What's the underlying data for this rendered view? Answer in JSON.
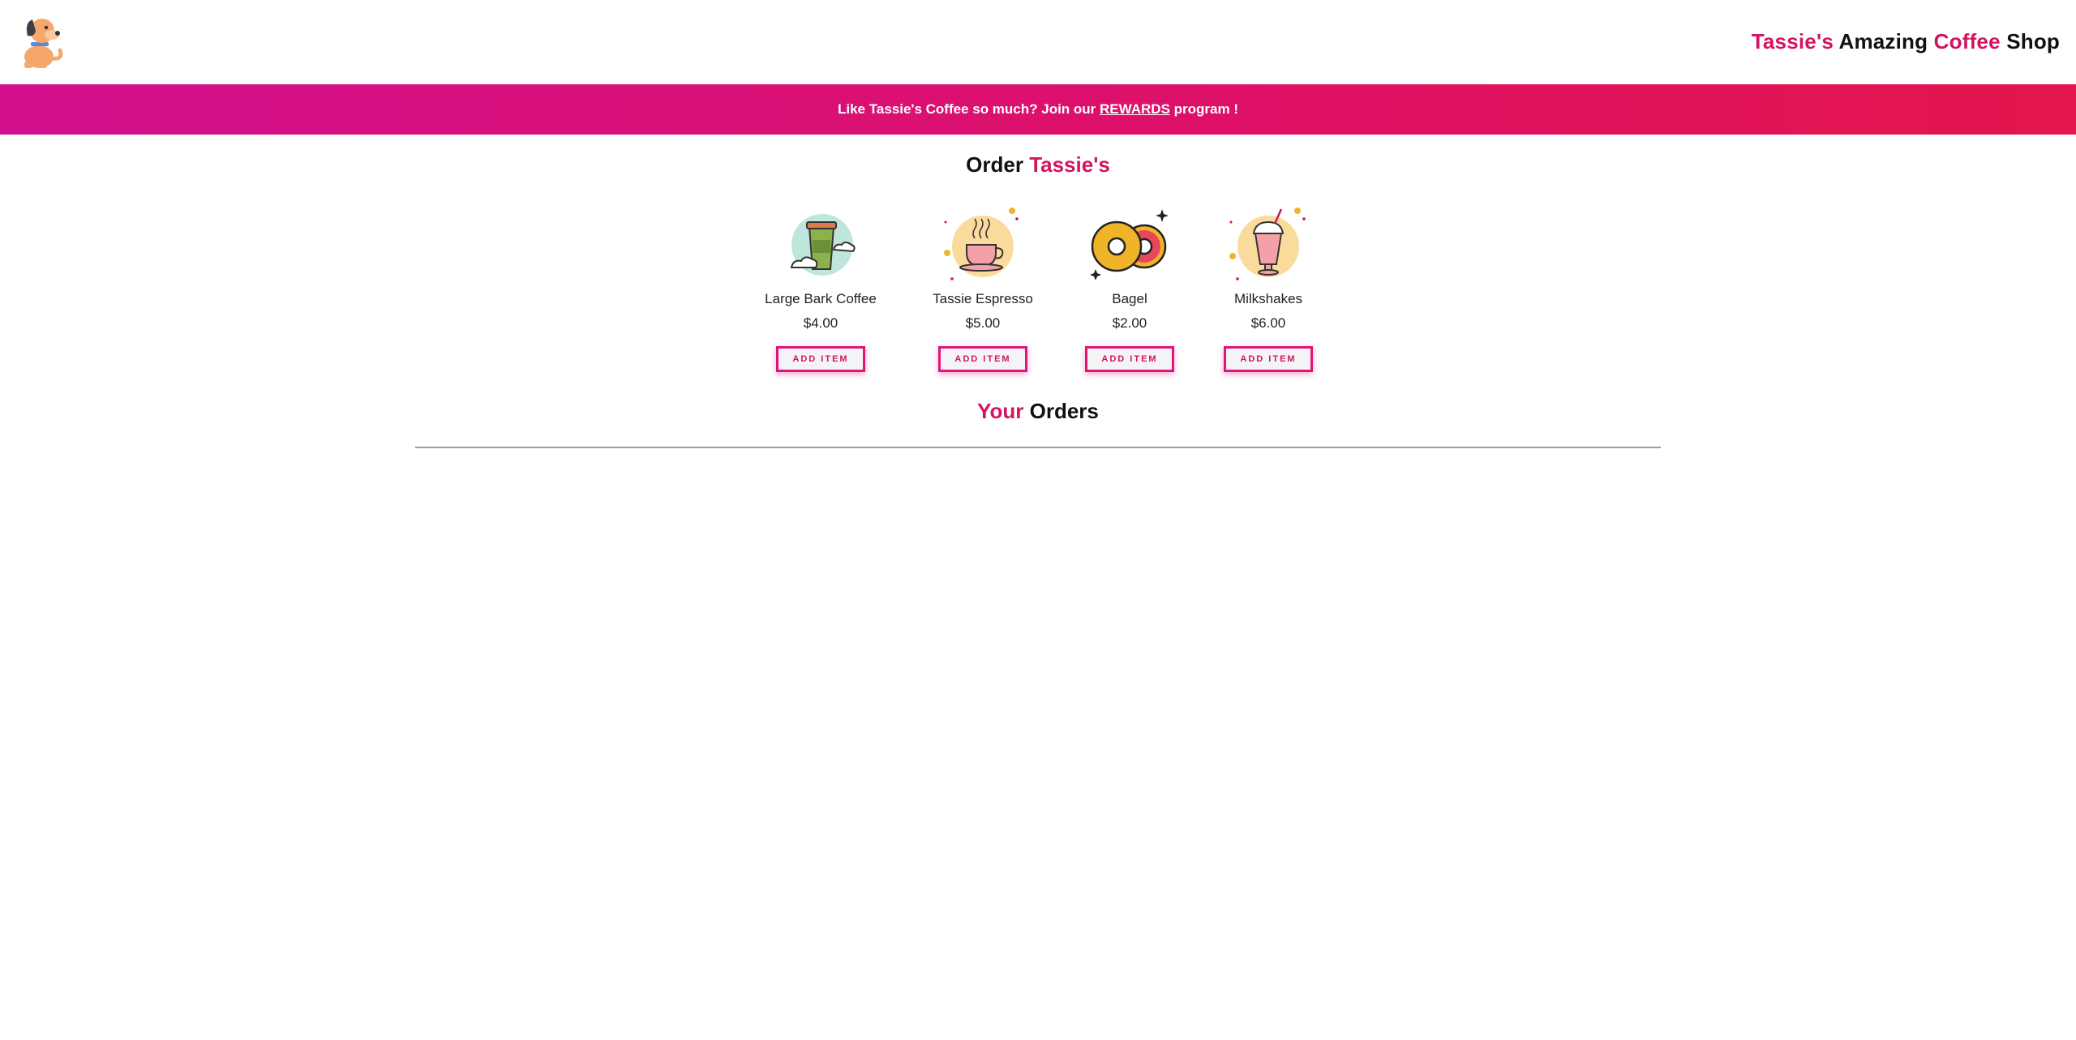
{
  "header": {
    "brand": {
      "part1": "Tassie's",
      "part2": "Amazing",
      "part3": "Coffee",
      "part4": "Shop"
    },
    "logo_icon": "dog-logo-icon"
  },
  "banner": {
    "prefix": "Like Tassie's Coffee so much? Join our ",
    "link": "REWARDS",
    "suffix": " program !"
  },
  "order_section": {
    "title_part1": "Order",
    "title_part2": "Tassie's"
  },
  "products": [
    {
      "name": "Large Bark Coffee",
      "price": "$4.00",
      "button": "ADD ITEM",
      "icon": "coffee-cup-icon"
    },
    {
      "name": "Tassie Espresso",
      "price": "$5.00",
      "button": "ADD ITEM",
      "icon": "espresso-cup-icon"
    },
    {
      "name": "Bagel",
      "price": "$2.00",
      "button": "ADD ITEM",
      "icon": "bagel-icon"
    },
    {
      "name": "Milkshakes",
      "price": "$6.00",
      "button": "ADD ITEM",
      "icon": "milkshake-icon"
    }
  ],
  "orders_section": {
    "title_part1": "Your",
    "title_part2": "Orders"
  },
  "colors": {
    "accent": "#d31461",
    "banner_start": "#d2108e",
    "banner_end": "#e3154c",
    "button_border": "#e0157a"
  }
}
